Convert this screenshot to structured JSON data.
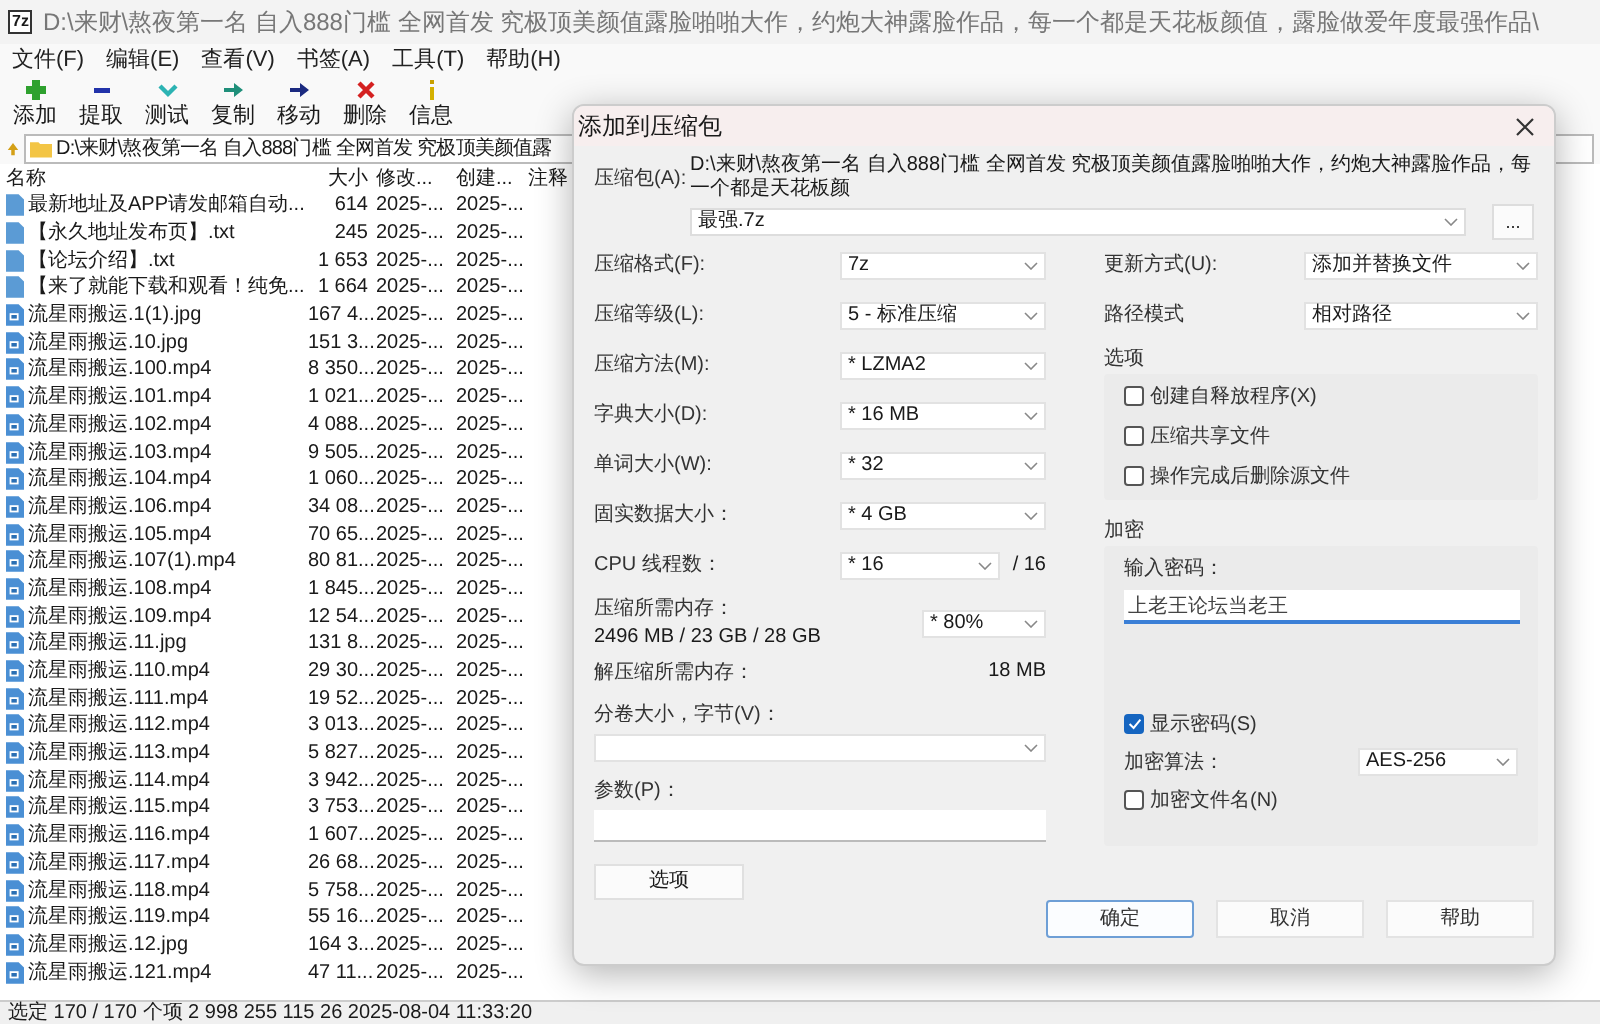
{
  "title_bar": {
    "app_icon_text": "7z",
    "title": "D:\\来财\\熬夜第一名 自入888门槛 全网首发 究极顶美颜值露脸啪啪大作，约炮大神露脸作品，每一个都是天花板颜值，露脸做爱年度最强作品\\"
  },
  "menu": [
    "文件(F)",
    "编辑(E)",
    "查看(V)",
    "书签(A)",
    "工具(T)",
    "帮助(H)"
  ],
  "toolbar": [
    {
      "label": "添加",
      "kind": "add"
    },
    {
      "label": "提取",
      "kind": "extract"
    },
    {
      "label": "测试",
      "kind": "test"
    },
    {
      "label": "复制",
      "kind": "copy"
    },
    {
      "label": "移动",
      "kind": "move"
    },
    {
      "label": "删除",
      "kind": "delete"
    },
    {
      "label": "信息",
      "kind": "info"
    }
  ],
  "address": {
    "path": "D:\\来财\\熬夜第一名 自入888门槛 全网首发 究极顶美颜值露"
  },
  "file_list": {
    "columns": [
      "名称",
      "大小",
      "修改...",
      "创建...",
      "注释"
    ],
    "rows": [
      {
        "name": "最新地址及APP请发邮箱自动...",
        "size": "614",
        "modified": "2025-...",
        "created": "2025-...",
        "kind": "doc"
      },
      {
        "name": "【永久地址发布页】.txt",
        "size": "245",
        "modified": "2025-...",
        "created": "2025-...",
        "kind": "doc"
      },
      {
        "name": "【论坛介绍】.txt",
        "size": "1 653",
        "modified": "2025-...",
        "created": "2025-...",
        "kind": "doc"
      },
      {
        "name": "【来了就能下载和观看！纯免...",
        "size": "1 664",
        "modified": "2025-...",
        "created": "2025-...",
        "kind": "doc"
      },
      {
        "name": "流星雨搬运.1(1).jpg",
        "size": "167 4...",
        "modified": "2025-...",
        "created": "2025-...",
        "kind": "media"
      },
      {
        "name": "流星雨搬运.10.jpg",
        "size": "151 3...",
        "modified": "2025-...",
        "created": "2025-...",
        "kind": "media"
      },
      {
        "name": "流星雨搬运.100.mp4",
        "size": "8 350...",
        "modified": "2025-...",
        "created": "2025-...",
        "kind": "media"
      },
      {
        "name": "流星雨搬运.101.mp4",
        "size": "1 021...",
        "modified": "2025-...",
        "created": "2025-...",
        "kind": "media"
      },
      {
        "name": "流星雨搬运.102.mp4",
        "size": "4 088...",
        "modified": "2025-...",
        "created": "2025-...",
        "kind": "media"
      },
      {
        "name": "流星雨搬运.103.mp4",
        "size": "9 505...",
        "modified": "2025-...",
        "created": "2025-...",
        "kind": "media"
      },
      {
        "name": "流星雨搬运.104.mp4",
        "size": "1 060...",
        "modified": "2025-...",
        "created": "2025-...",
        "kind": "media"
      },
      {
        "name": "流星雨搬运.106.mp4",
        "size": "34 08...",
        "modified": "2025-...",
        "created": "2025-...",
        "kind": "media"
      },
      {
        "name": "流星雨搬运.105.mp4",
        "size": "70 65...",
        "modified": "2025-...",
        "created": "2025-...",
        "kind": "media"
      },
      {
        "name": "流星雨搬运.107(1).mp4",
        "size": "80 81...",
        "modified": "2025-...",
        "created": "2025-...",
        "kind": "media"
      },
      {
        "name": "流星雨搬运.108.mp4",
        "size": "1 845...",
        "modified": "2025-...",
        "created": "2025-...",
        "kind": "media"
      },
      {
        "name": "流星雨搬运.109.mp4",
        "size": "12 54...",
        "modified": "2025-...",
        "created": "2025-...",
        "kind": "media"
      },
      {
        "name": "流星雨搬运.11.jpg",
        "size": "131 8...",
        "modified": "2025-...",
        "created": "2025-...",
        "kind": "media"
      },
      {
        "name": "流星雨搬运.110.mp4",
        "size": "29 30...",
        "modified": "2025-...",
        "created": "2025-...",
        "kind": "media"
      },
      {
        "name": "流星雨搬运.111.mp4",
        "size": "19 52...",
        "modified": "2025-...",
        "created": "2025-...",
        "kind": "media"
      },
      {
        "name": "流星雨搬运.112.mp4",
        "size": "3 013...",
        "modified": "2025-...",
        "created": "2025-...",
        "kind": "media"
      },
      {
        "name": "流星雨搬运.113.mp4",
        "size": "5 827...",
        "modified": "2025-...",
        "created": "2025-...",
        "kind": "media"
      },
      {
        "name": "流星雨搬运.114.mp4",
        "size": "3 942...",
        "modified": "2025-...",
        "created": "2025-...",
        "kind": "media"
      },
      {
        "name": "流星雨搬运.115.mp4",
        "size": "3 753...",
        "modified": "2025-...",
        "created": "2025-...",
        "kind": "media"
      },
      {
        "name": "流星雨搬运.116.mp4",
        "size": "1 607...",
        "modified": "2025-...",
        "created": "2025-...",
        "kind": "media"
      },
      {
        "name": "流星雨搬运.117.mp4",
        "size": "26 68...",
        "modified": "2025-...",
        "created": "2025-...",
        "kind": "media"
      },
      {
        "name": "流星雨搬运.118.mp4",
        "size": "5 758...",
        "modified": "2025-...",
        "created": "2025-...",
        "kind": "media"
      },
      {
        "name": "流星雨搬运.119.mp4",
        "size": "55 16...",
        "modified": "2025-...",
        "created": "2025-...",
        "kind": "media"
      },
      {
        "name": "流星雨搬运.12.jpg",
        "size": "164 3...",
        "modified": "2025-...",
        "created": "2025-...",
        "kind": "media"
      },
      {
        "name": "流星雨搬运.121.mp4",
        "size": "47 11...",
        "modified": "2025-...",
        "created": "2025-...",
        "kind": "media"
      }
    ]
  },
  "status_bar": "选定 170 / 170 个项 2 998 255 115 26 2025-08-04 11:33:20",
  "dialog": {
    "title": "添加到压缩包",
    "archive": {
      "label": "压缩包(A):",
      "path_line": "D:\\来财\\熬夜第一名 自入888门槛 全网首发 究极顶美颜值露脸啪啪大作，约炮大神露脸作品，每一个都是天花板颜",
      "name": "最强.7z",
      "browse": "..."
    },
    "settings": [
      {
        "label": "压缩格式(F):",
        "value": "7z"
      },
      {
        "label": "压缩等级(L):",
        "value": "5 - 标准压缩"
      },
      {
        "label": "压缩方法(M):",
        "value": "* LZMA2"
      },
      {
        "label": "字典大小(D):",
        "value": "* 16 MB"
      },
      {
        "label": "单词大小(W):",
        "value": "* 32"
      },
      {
        "label": "固实数据大小：",
        "value": "* 4 GB"
      },
      {
        "label": "CPU 线程数：",
        "value": "* 16",
        "suffix": "/ 16"
      }
    ],
    "memory": {
      "label": "压缩所需内存：",
      "value": "2496 MB / 23 GB / 28 GB",
      "percent": "* 80%"
    },
    "decompress_memory": {
      "label": "解压缩所需内存：",
      "value": "18 MB"
    },
    "volume": {
      "label": "分卷大小，字节(V)："
    },
    "parameters": {
      "label": "参数(P)："
    },
    "options_button": "选项",
    "update_mode": {
      "label": "更新方式(U):",
      "value": "添加并替换文件"
    },
    "path_mode": {
      "label": "路径模式",
      "value": "相对路径"
    },
    "options_group": {
      "title": "选项",
      "checkboxes": [
        {
          "label": "创建自释放程序(X)",
          "checked": false
        },
        {
          "label": "压缩共享文件",
          "checked": false
        },
        {
          "label": "操作完成后删除源文件",
          "checked": false
        }
      ]
    },
    "encryption": {
      "title": "加密",
      "password_label": "输入密码：",
      "password": "上老王论坛当老王",
      "show_password": {
        "label": "显示密码(S)",
        "checked": true
      },
      "method_label": "加密算法：",
      "method": "AES-256",
      "encrypt_names": {
        "label": "加密文件名(N)",
        "checked": false
      }
    },
    "buttons": [
      {
        "label": "确定",
        "default": true
      },
      {
        "label": "取消",
        "default": false
      },
      {
        "label": "帮助",
        "default": false
      }
    ]
  }
}
